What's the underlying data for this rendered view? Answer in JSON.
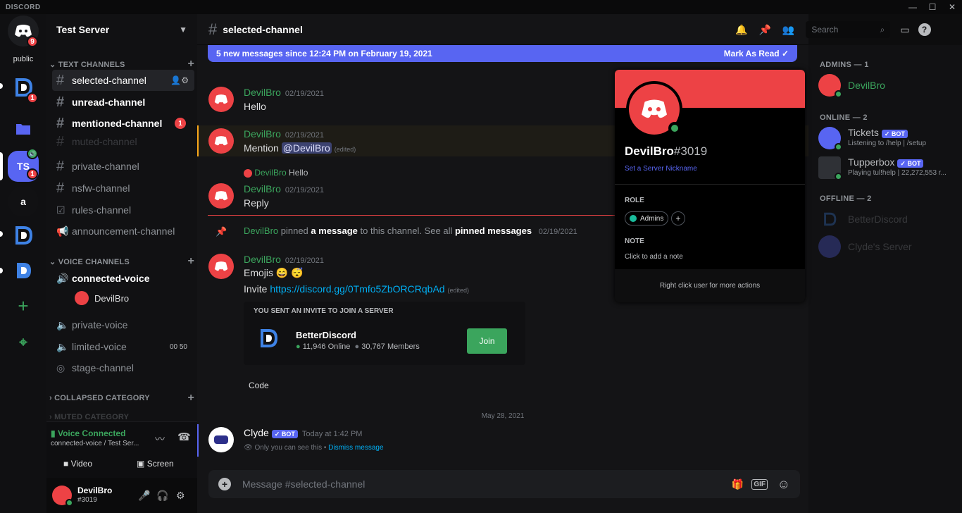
{
  "app": {
    "brand": "DISCORD",
    "window_controls": [
      "—",
      "☐",
      "✕"
    ]
  },
  "guilds": {
    "home_badge": "9",
    "public_label": "public",
    "items": [
      {
        "label": "",
        "badge": "1"
      },
      {
        "label": "",
        "badge": ""
      },
      {
        "label": "TS",
        "badge": "1"
      },
      {
        "label": "a",
        "badge": ""
      },
      {
        "label": "",
        "badge": ""
      },
      {
        "label": "",
        "badge": ""
      }
    ],
    "add": "+",
    "explore": "⌖"
  },
  "server": {
    "name": "Test Server"
  },
  "categories": {
    "text": "TEXT CHANNELS",
    "voice": "VOICE CHANNELS",
    "collapsed": "COLLAPSED CATEGORY",
    "muted": "MUTED CATEGORY"
  },
  "text_channels": [
    {
      "name": "selected-channel",
      "state": "selected"
    },
    {
      "name": "unread-channel",
      "state": "unread"
    },
    {
      "name": "mentioned-channel",
      "state": "unread",
      "badge": "1"
    },
    {
      "name": "muted-channel",
      "state": "muted"
    },
    {
      "name": "private-channel",
      "state": "normal"
    },
    {
      "name": "nsfw-channel",
      "state": "normal"
    },
    {
      "name": "rules-channel",
      "state": "normal"
    },
    {
      "name": "announcement-channel",
      "state": "normal"
    }
  ],
  "voice_channels": [
    {
      "name": "connected-voice",
      "state": "active"
    },
    {
      "name": "private-voice",
      "state": "normal"
    },
    {
      "name": "limited-voice",
      "state": "normal",
      "limit": "00  50"
    },
    {
      "name": "stage-channel",
      "state": "normal"
    }
  ],
  "voice_user": "DevilBro",
  "voice_panel": {
    "status": "Voice Connected",
    "location": "connected-voice / Test Ser...",
    "video": "Video",
    "screen": "Screen"
  },
  "user": {
    "name": "DevilBro",
    "tag": "#3019"
  },
  "chat": {
    "channel": "selected-channel",
    "search_placeholder": "Search",
    "banner_text": "5 new messages since 12:24 PM on February 19, 2021",
    "mark_read": "Mark As Read",
    "messages": [
      {
        "author": "DevilBro",
        "ts": "02/19/2021",
        "text": "Hello"
      },
      {
        "author": "DevilBro",
        "ts": "02/19/2021",
        "text_prefix": "Mention",
        "mention": "@DevilBro",
        "edited": "(edited)"
      },
      {
        "reply_author": "DevilBro",
        "reply_text": "Hello",
        "author": "DevilBro",
        "ts": "02/19/2021",
        "text": "Reply"
      }
    ],
    "pin": {
      "author": "DevilBro",
      "part1": "pinned",
      "link1": "a message",
      "part2": "to this channel. See all",
      "link2": "pinned messages",
      "ts": "02/19/2021"
    },
    "emoji_msg": {
      "author": "DevilBro",
      "ts": "02/19/2021",
      "line1": "Emojis",
      "emojis": "😄 😴",
      "line2_prefix": "Invite",
      "link": "https://discord.gg/0Tmfo5ZbORCRqbAd",
      "edited": "(edited)"
    },
    "invite": {
      "heading": "YOU SENT AN INVITE TO JOIN A SERVER",
      "server": "BetterDiscord",
      "online": "11,946 Online",
      "members": "30,767 Members",
      "join": "Join"
    },
    "code_label": "Code",
    "divider_date": "May 28, 2021",
    "clyde": {
      "author": "Clyde",
      "badge": "✓ BOT",
      "ts": "Today at 1:42 PM",
      "only_you": "Only you can see this •",
      "dismiss": "Dismiss message"
    },
    "composer_placeholder": "Message #selected-channel"
  },
  "popout": {
    "name": "DevilBro",
    "tag": "#3019",
    "nickname_link": "Set a Server Nickname",
    "role_heading": "ROLE",
    "role": "Admins",
    "note_heading": "NOTE",
    "note_placeholder": "Click to add a note",
    "footer": "Right click user for more actions"
  },
  "members": {
    "admins_heading": "ADMINS — 1",
    "online_heading": "ONLINE — 2",
    "offline_heading": "OFFLINE — 2",
    "admins": [
      {
        "name": "DevilBro"
      }
    ],
    "online": [
      {
        "name": "Tickets",
        "badge": "✓ BOT",
        "activity": "Listening to /help | /setup"
      },
      {
        "name": "Tupperbox",
        "badge": "✓ BOT",
        "activity": "Playing tul!help | 22,272,553 r..."
      }
    ],
    "offline": [
      {
        "name": "BetterDiscord"
      },
      {
        "name": "Clyde's Server"
      }
    ]
  },
  "colors": {
    "accent": "#5865f2",
    "red": "#ed4245",
    "green": "#3ba55d"
  }
}
